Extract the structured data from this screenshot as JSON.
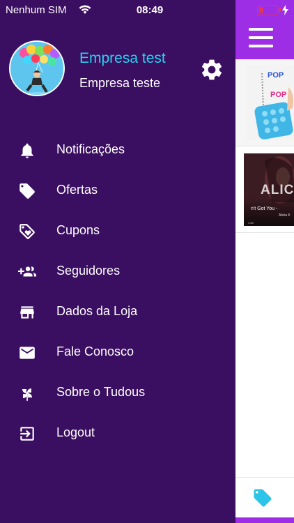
{
  "status_bar": {
    "carrier": "Nenhum SIM",
    "time": "08:49",
    "battery_color": "#e8374a"
  },
  "profile": {
    "name": "Empresa test",
    "subtitle": "Empresa teste",
    "name_color": "#27d3f1"
  },
  "menu": {
    "items": [
      {
        "label": "Notificações",
        "icon": "bell-icon"
      },
      {
        "label": "Ofertas",
        "icon": "tag-icon"
      },
      {
        "label": "Cupons",
        "icon": "coupon-heart-icon"
      },
      {
        "label": "Seguidores",
        "icon": "add-group-icon"
      },
      {
        "label": "Dados da Loja",
        "icon": "store-icon"
      },
      {
        "label": "Fale Conosco",
        "icon": "mail-icon"
      },
      {
        "label": "Sobre o Tudous",
        "icon": "pinwheel-icon"
      },
      {
        "label": "Logout",
        "icon": "logout-icon"
      }
    ]
  },
  "background_app": {
    "header_color": "#9d2ee6",
    "drawer_color": "#3a0e60",
    "card1_text": "POP",
    "card2_big_text": "ALICIA",
    "card2_song": "n't Got You -",
    "card2_artist": "Alicia K",
    "card2_time": "1:54"
  }
}
